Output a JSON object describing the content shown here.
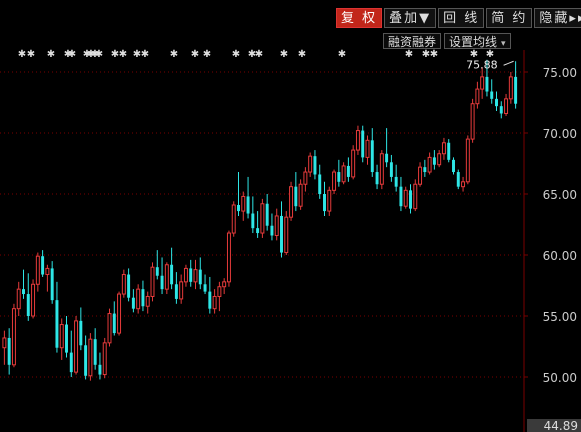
{
  "top_menu": {
    "items": [
      "…",
      "…",
      "…",
      "…",
      "…",
      "…",
      "…",
      "…"
    ]
  },
  "toolbar": {
    "restore_right": "复 权",
    "overlay": "叠加▼",
    "line": "回 线",
    "simple": "简 约",
    "hide": "隐藏▸▸"
  },
  "subtoolbar": {
    "margin_trading": "融资融券",
    "ma_settings": "设置均线",
    "ma_caret": "▾"
  },
  "price_axis": {
    "ticks": [
      "50.00",
      "55.00",
      "60.00",
      "65.00",
      "70.00",
      "75.00"
    ],
    "current": "44.89"
  },
  "annotation": {
    "high_label": "75.88"
  },
  "marker_glyph": "✱",
  "colors": {
    "up": "#e63b3b",
    "down": "#2ee6e6",
    "grid": "#7a0000",
    "axis_text": "#cccccc",
    "active_button": "#c2261a"
  },
  "chart_data": {
    "type": "candlestick",
    "ylim": [
      44.89,
      76.5
    ],
    "y_ticks": [
      50,
      55,
      60,
      65,
      70,
      75
    ],
    "candles": [
      [
        52.4,
        53.8,
        51.0,
        53.2
      ],
      [
        53.2,
        54.0,
        50.2,
        51.0
      ],
      [
        51.0,
        56.0,
        50.8,
        55.6
      ],
      [
        55.6,
        57.8,
        55.0,
        57.2
      ],
      [
        57.2,
        58.8,
        56.4,
        56.8
      ],
      [
        56.8,
        58.5,
        54.6,
        55.0
      ],
      [
        55.0,
        58.0,
        54.8,
        57.6
      ],
      [
        57.6,
        60.2,
        57.0,
        59.9
      ],
      [
        59.9,
        60.4,
        58.2,
        58.4
      ],
      [
        58.4,
        59.2,
        57.0,
        58.9
      ],
      [
        58.9,
        59.5,
        56.0,
        56.3
      ],
      [
        56.3,
        57.8,
        52.0,
        52.4
      ],
      [
        52.4,
        54.8,
        51.4,
        54.3
      ],
      [
        54.3,
        55.0,
        51.6,
        52.0
      ],
      [
        52.0,
        53.8,
        50.0,
        50.4
      ],
      [
        50.4,
        55.0,
        50.2,
        54.6
      ],
      [
        54.6,
        55.7,
        52.2,
        52.6
      ],
      [
        52.6,
        53.4,
        49.8,
        50.1
      ],
      [
        50.1,
        53.6,
        49.7,
        53.1
      ],
      [
        53.1,
        54.0,
        50.6,
        51.0
      ],
      [
        51.0,
        52.0,
        49.8,
        50.2
      ],
      [
        50.2,
        53.2,
        49.9,
        52.8
      ],
      [
        52.8,
        55.6,
        52.5,
        55.2
      ],
      [
        55.2,
        56.2,
        53.4,
        53.6
      ],
      [
        53.6,
        57.0,
        53.4,
        56.8
      ],
      [
        56.8,
        58.8,
        56.5,
        58.4
      ],
      [
        58.4,
        58.9,
        56.2,
        56.5
      ],
      [
        56.5,
        57.2,
        55.3,
        55.6
      ],
      [
        55.6,
        57.6,
        55.2,
        57.2
      ],
      [
        57.2,
        57.9,
        55.4,
        55.8
      ],
      [
        55.8,
        57.0,
        55.2,
        56.6
      ],
      [
        56.6,
        59.4,
        56.2,
        59.0
      ],
      [
        59.0,
        60.4,
        58.0,
        58.3
      ],
      [
        58.3,
        59.8,
        56.8,
        57.2
      ],
      [
        57.2,
        59.4,
        56.8,
        59.2
      ],
      [
        59.2,
        60.6,
        57.2,
        57.6
      ],
      [
        57.6,
        58.6,
        56.0,
        56.4
      ],
      [
        56.4,
        58.4,
        56.0,
        57.8
      ],
      [
        57.8,
        59.2,
        57.4,
        58.9
      ],
      [
        58.9,
        59.6,
        57.4,
        57.8
      ],
      [
        57.8,
        59.6,
        57.2,
        58.8
      ],
      [
        58.8,
        59.8,
        57.2,
        57.6
      ],
      [
        57.6,
        58.4,
        56.8,
        57.0
      ],
      [
        57.0,
        58.2,
        55.2,
        55.6
      ],
      [
        55.6,
        57.2,
        55.2,
        56.6
      ],
      [
        56.6,
        57.8,
        55.4,
        57.4
      ],
      [
        57.4,
        58.1,
        56.8,
        57.8
      ],
      [
        57.8,
        62.0,
        57.4,
        61.8
      ],
      [
        61.8,
        64.4,
        61.5,
        64.1
      ],
      [
        64.1,
        66.8,
        63.2,
        63.6
      ],
      [
        63.6,
        65.2,
        62.8,
        64.8
      ],
      [
        64.8,
        66.4,
        63.0,
        63.4
      ],
      [
        63.4,
        64.8,
        61.8,
        62.2
      ],
      [
        62.2,
        63.6,
        61.4,
        61.8
      ],
      [
        61.8,
        64.6,
        61.4,
        64.2
      ],
      [
        64.2,
        65.0,
        62.0,
        62.4
      ],
      [
        62.4,
        63.4,
        61.2,
        61.6
      ],
      [
        61.6,
        63.8,
        61.2,
        63.2
      ],
      [
        63.2,
        64.4,
        59.8,
        60.2
      ],
      [
        60.2,
        63.6,
        60.0,
        63.1
      ],
      [
        63.1,
        66.0,
        62.8,
        65.6
      ],
      [
        65.6,
        66.8,
        63.6,
        64.0
      ],
      [
        64.0,
        66.2,
        63.7,
        65.8
      ],
      [
        65.8,
        67.2,
        65.2,
        66.8
      ],
      [
        66.8,
        68.4,
        66.4,
        68.1
      ],
      [
        68.1,
        68.6,
        66.2,
        66.6
      ],
      [
        66.6,
        67.4,
        64.6,
        65.0
      ],
      [
        65.0,
        66.0,
        63.2,
        63.6
      ],
      [
        63.6,
        65.6,
        63.2,
        65.3
      ],
      [
        65.3,
        67.0,
        65.0,
        66.8
      ],
      [
        66.8,
        67.8,
        65.6,
        66.0
      ],
      [
        66.0,
        67.6,
        65.8,
        67.3
      ],
      [
        67.3,
        68.0,
        66.0,
        66.4
      ],
      [
        66.4,
        69.0,
        66.2,
        68.6
      ],
      [
        68.6,
        70.6,
        68.2,
        70.2
      ],
      [
        70.2,
        70.6,
        67.6,
        68.0
      ],
      [
        68.0,
        69.8,
        67.4,
        69.4
      ],
      [
        69.4,
        70.4,
        66.4,
        66.8
      ],
      [
        66.8,
        67.4,
        65.4,
        65.8
      ],
      [
        65.8,
        68.6,
        65.4,
        68.3
      ],
      [
        68.3,
        70.4,
        67.2,
        67.6
      ],
      [
        67.6,
        68.2,
        66.0,
        66.4
      ],
      [
        66.4,
        67.4,
        65.2,
        65.6
      ],
      [
        65.6,
        66.4,
        63.6,
        64.0
      ],
      [
        64.0,
        65.6,
        63.8,
        65.3
      ],
      [
        65.3,
        65.8,
        63.4,
        63.8
      ],
      [
        63.8,
        66.2,
        63.6,
        65.8
      ],
      [
        65.8,
        67.6,
        65.6,
        67.2
      ],
      [
        67.2,
        67.8,
        66.4,
        66.8
      ],
      [
        66.8,
        68.4,
        66.6,
        68.0
      ],
      [
        68.0,
        68.6,
        67.0,
        67.4
      ],
      [
        67.4,
        68.6,
        67.2,
        68.3
      ],
      [
        68.3,
        69.6,
        67.8,
        69.2
      ],
      [
        69.2,
        69.5,
        67.6,
        67.8
      ],
      [
        67.8,
        68.0,
        66.6,
        66.8
      ],
      [
        66.8,
        67.0,
        65.4,
        65.6
      ],
      [
        65.6,
        66.4,
        65.2,
        66.0
      ],
      [
        66.0,
        69.8,
        65.8,
        69.5
      ],
      [
        69.5,
        72.8,
        69.2,
        72.4
      ],
      [
        72.4,
        74.2,
        72.0,
        73.6
      ],
      [
        73.6,
        75.4,
        72.8,
        74.6
      ],
      [
        74.6,
        76.0,
        73.0,
        73.4
      ],
      [
        73.4,
        74.4,
        72.4,
        72.8
      ],
      [
        72.8,
        73.4,
        71.8,
        72.2
      ],
      [
        72.2,
        72.6,
        71.2,
        71.6
      ],
      [
        71.6,
        73.2,
        71.4,
        72.8
      ],
      [
        72.8,
        75.0,
        72.4,
        74.6
      ],
      [
        74.6,
        75.88,
        72.0,
        72.4
      ]
    ]
  },
  "marker_rows": {
    "top_row_x": [
      22,
      31,
      51,
      68,
      72,
      87,
      91,
      95,
      99,
      115,
      123,
      137,
      145,
      174,
      195,
      207,
      236,
      252,
      259,
      284,
      302,
      342
    ],
    "right_row_x": [
      409,
      426,
      434,
      474,
      490
    ]
  }
}
